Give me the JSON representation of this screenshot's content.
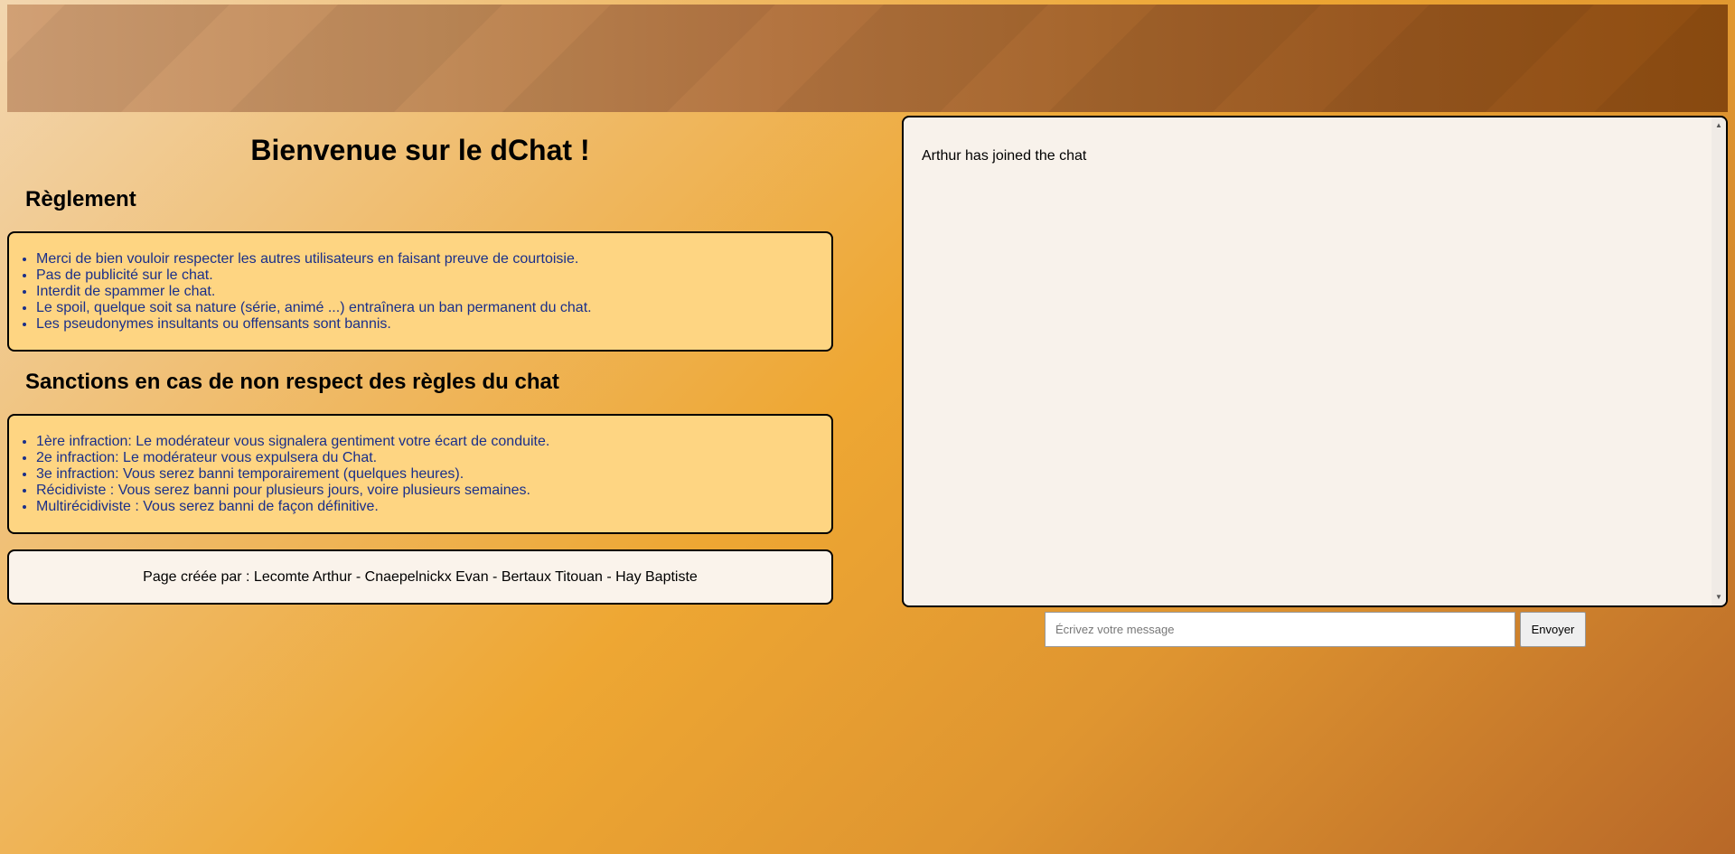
{
  "header": {
    "title": "Bienvenue sur le dChat !"
  },
  "rules": {
    "title": "Règlement",
    "items": [
      "Merci de bien vouloir respecter les autres utilisateurs en faisant preuve de courtoisie.",
      "Pas de publicité sur le chat.",
      "Interdit de spammer le chat.",
      "Le spoil, quelque soit sa nature (série, animé ...) entraînera un ban permanent du chat.",
      "Les pseudonymes insultants ou offensants sont bannis."
    ]
  },
  "sanctions": {
    "title": "Sanctions en cas de non respect des règles du chat",
    "items": [
      "1ère infraction: Le modérateur vous signalera gentiment votre écart de conduite.",
      "2e infraction: Le modérateur vous expulsera du Chat.",
      "3e infraction: Vous serez banni temporairement (quelques heures).",
      "Récidiviste : Vous serez banni pour plusieurs jours, voire plusieurs semaines.",
      "Multirécidiviste : Vous serez banni de façon définitive."
    ]
  },
  "footer": {
    "credits": "Page créée par : Lecomte Arthur - Cnaepelnickx Evan - Bertaux Titouan - Hay Baptiste"
  },
  "chat": {
    "messages": [
      "Arthur has joined the chat"
    ],
    "input_placeholder": "Écrivez votre message",
    "input_value": "",
    "send_label": "Envoyer"
  },
  "colors": {
    "box_background": "#fed582",
    "list_text": "#1a2f8a",
    "chat_background": "#f8f2eb"
  }
}
